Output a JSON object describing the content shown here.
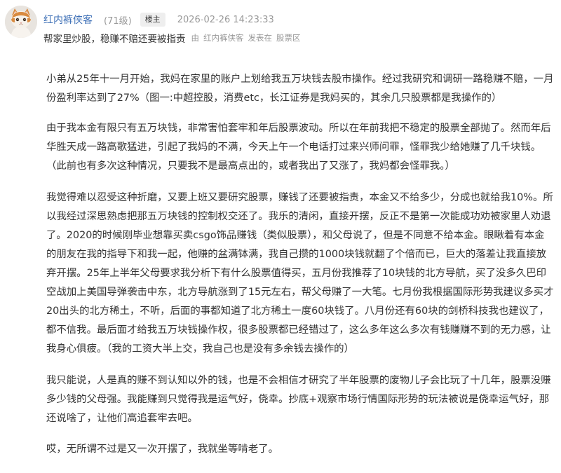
{
  "post": {
    "author": "红内裤侠客",
    "level": "(71级)",
    "badge": "楼主",
    "timestamp": "2026-02-26 14:23:33",
    "title": "帮家里炒股，稳赚不赔还要被指责",
    "posted_by_prefix": "由",
    "posted_by_author": "红内裤侠客",
    "posted_in": "发表在",
    "board": "股票区",
    "avatar_icon": "cat-avatar-icon"
  },
  "body": {
    "paragraphs": [
      "小弟从25年十一月开始，我妈在家里的账户上划给我五万块钱去股市操作。经过我研究和调研一路稳赚不赔，一月份盈利率达到了27%（图一:中超控股，消费etc，长江证券是我妈买的，其余几只股票都是我操作的）",
      "由于我本金有限只有五万块钱，非常害怕套牢和年后股票波动。所以在年前我把不稳定的股票全部抛了。然而年后华胜天成一路高歌猛进，引起了我妈的不满，今天上午一个电话打过来兴师问罪，怪罪我少给她赚了几千块钱。（此前也有多次这种情况，只要我不是最高点出的，或者我出了又涨了，我妈都会怪罪我。）",
      "我觉得难以忍受这种折磨，又要上班又要研究股票，赚钱了还要被指责，本金又不给多少，分成也就给我10%。所以我经过深思熟虑把那五万块钱的控制权交还了。我乐的清闲，直接开摆，反正不是第一次能成功劝被家里人劝退了。2020的时候刚毕业想靠买卖csgo饰品赚钱（类似股票），和父母说了，但是不同意不给本金。眼瞅着有本金的朋友在我的指导下和我一起，他赚的盆满钵满，我自己攒的1000块钱就翻了个倍而已，巨大的落差让我直接放弃开摆。25年上半年父母要求我分析下有什么股票值得买，五月份我推荐了10块钱的北方导航，买了没多久巴印空战加上美国导弹袭击中东，北方导航涨到了15元左右，帮父母赚了一大笔。七月份我根据国际形势我建议多买才20出头的北方稀土，不听，后面的事都知道了北方稀土一度60块钱了。八月份还有60块的剑桥科技我也建议了，都不信我。最后面才给我五万块钱操作权，很多股票都已经错过了，这么多年这么多次有钱赚赚不到的无力感，让我身心俱疲。（我的工资大半上交，我自己也是没有多余钱去操作的）",
      "我只能说，人是真的赚不到认知以外的钱，也是不会相信才研究了半年股票的废物儿子会比玩了十几年，股票没赚多少钱的父母强。我能赚到只觉得我是运气好，侥幸。抄底+观察市场行情国际形势的玩法被说是侥幸运气好，那还说啥了，让他们高追套牢去吧。",
      "哎，无所谓不过是又一次开摆了，我就坐等啃老了。"
    ]
  }
}
